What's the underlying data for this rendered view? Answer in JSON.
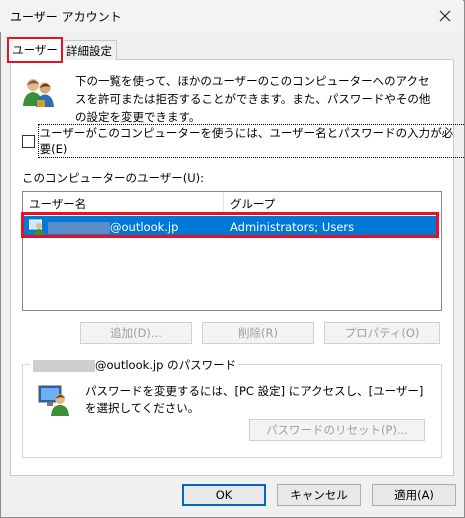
{
  "window": {
    "title": "ユーザー アカウント"
  },
  "tabs": [
    {
      "label": "ユーザー"
    },
    {
      "label": "詳細設定"
    }
  ],
  "description": "下の一覧を使って、ほかのユーザーのこのコンピューターへのアクセスを許可または拒否することができます。また、パスワードやその他の設定を変更できます。",
  "require_login": {
    "label": "ユーザーがこのコンピューターを使うには、ユーザー名とパスワードの入力が必要(E)",
    "checked": false
  },
  "users_label": "このコンピューターのユーザー(U):",
  "table": {
    "headers": [
      "ユーザー名",
      "グループ"
    ],
    "rows": [
      {
        "user_suffix": "@outlook.jp",
        "group": "Administrators; Users"
      }
    ]
  },
  "list_buttons": {
    "add": "追加(D)...",
    "remove": "削除(R)",
    "properties": "プロパティ(O)"
  },
  "password_group": {
    "title_suffix": "@outlook.jp のパスワード",
    "text": "パスワードを変更するには、[PC 設定] にアクセスし、[ユーザー] を選択してください。",
    "reset_button": "パスワードのリセット(P)..."
  },
  "dialog_buttons": {
    "ok": "OK",
    "cancel": "キャンセル",
    "apply": "適用(A)"
  }
}
